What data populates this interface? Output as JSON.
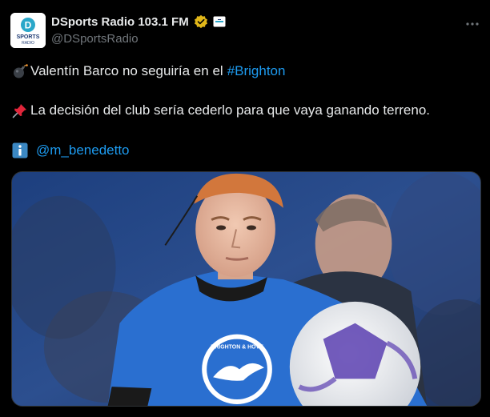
{
  "account": {
    "display_name": "DSports Radio 103.1 FM",
    "handle": "@DSportsRadio",
    "avatar_text_d": "D",
    "avatar_text_brand": "SPORTS",
    "avatar_text_sub": "RADIO"
  },
  "tweet": {
    "line1_text": "Valentín Barco no seguiría en el",
    "line1_hashtag": "#Brighton",
    "line2_text": "La decisión del club sería cederlo para que vaya ganando terreno.",
    "line3_mention": "@m_benedetto"
  },
  "media": {
    "shirt_text": "BRIGHTON & HOVE"
  },
  "colors": {
    "background": "#000000",
    "text": "#e7e9ea",
    "secondary": "#71767b",
    "link": "#1d9bf0",
    "verified": "#e2b719"
  },
  "icons": [
    "verified-icon",
    "affiliate-badge-icon",
    "more-options-icon",
    "bomb-emoji-icon",
    "pushpin-emoji-icon",
    "info-emoji-icon"
  ]
}
